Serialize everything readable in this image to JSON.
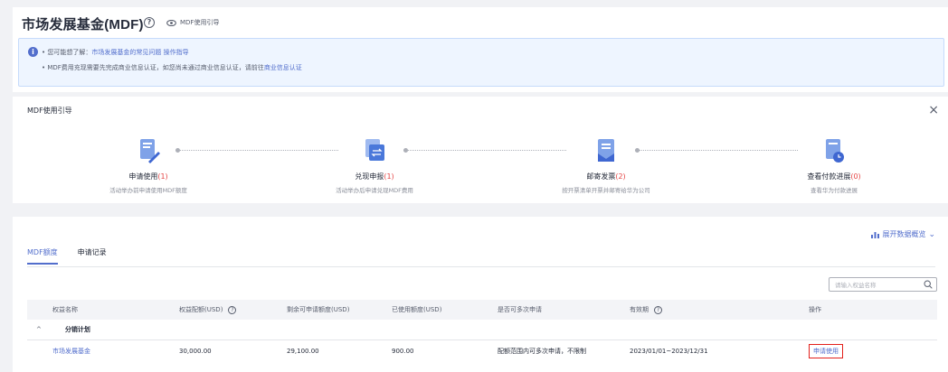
{
  "header": {
    "title": "市场发展基金(MDF)",
    "guide_link": "MDF使用引导"
  },
  "notice": {
    "prefix": "• 您可能想了解：",
    "link1": "市场发展基金的常见问题",
    "link2": "操作指导",
    "line2_text": "• MDF费用充现需要先完成商业信息认证，如您尚未通过商业信息认证，请前往",
    "line2_link": "商业信息认证"
  },
  "guide": {
    "title": "MDF使用引导",
    "steps": [
      {
        "name": "申请使用",
        "count": "(1)",
        "desc": "活动举办前申请使用MDF额度"
      },
      {
        "name": "兑现申报",
        "count": "(1)",
        "desc": "活动举办后申请兑现MDF费用"
      },
      {
        "name": "邮寄发票",
        "count": "(2)",
        "desc": "按开票清单开票并邮寄给华为公司"
      },
      {
        "name": "查看付款进展",
        "count": "(0)",
        "desc": "查看华为付款进展"
      }
    ]
  },
  "main": {
    "expand_label": "展开数据概览",
    "tabs": [
      "MDF额度",
      "申请记录"
    ],
    "search_placeholder": "请输入权益名称",
    "columns": [
      "权益名称",
      "权益配额(USD)",
      "剩余可申请额度(USD)",
      "已使用额度(USD)",
      "是否可多次申请",
      "有效期",
      "操作"
    ],
    "group": "分销计划",
    "rows": [
      {
        "name": "市场发展基金",
        "quota": "30,000.00",
        "remaining": "29,100.00",
        "used": "900.00",
        "multiple": "配额范围内可多次申请，不限制",
        "validity": "2023/01/01~2023/12/31",
        "action": "申请使用"
      }
    ]
  },
  "colors": {
    "accent": "#526ecc",
    "alert": "#e54545",
    "highlight_border": "#e3201b"
  }
}
